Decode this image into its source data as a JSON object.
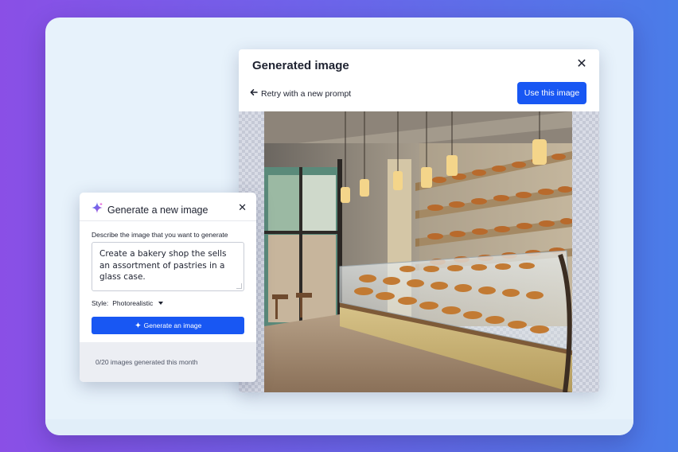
{
  "generated_modal": {
    "title": "Generated image",
    "retry_label": "Retry with a new prompt",
    "use_button": "Use this image"
  },
  "generate_dialog": {
    "title": "Generate a new image",
    "prompt_label": "Describe the image that you want to generate",
    "prompt_value": "Create a bakery shop the sells an assortment of pastries in a glass case.",
    "style_label": "Style:",
    "style_value": "Photorealistic",
    "generate_button": "Generate an image",
    "usage_text": "0/20 images generated this month"
  },
  "colors": {
    "accent": "#1857f3",
    "background_gradient_start": "#8a4fe6",
    "background_gradient_end": "#4a7ce8"
  },
  "icons": [
    "close-icon",
    "arrow-left-icon",
    "sparkle-icon",
    "caret-down-icon"
  ]
}
